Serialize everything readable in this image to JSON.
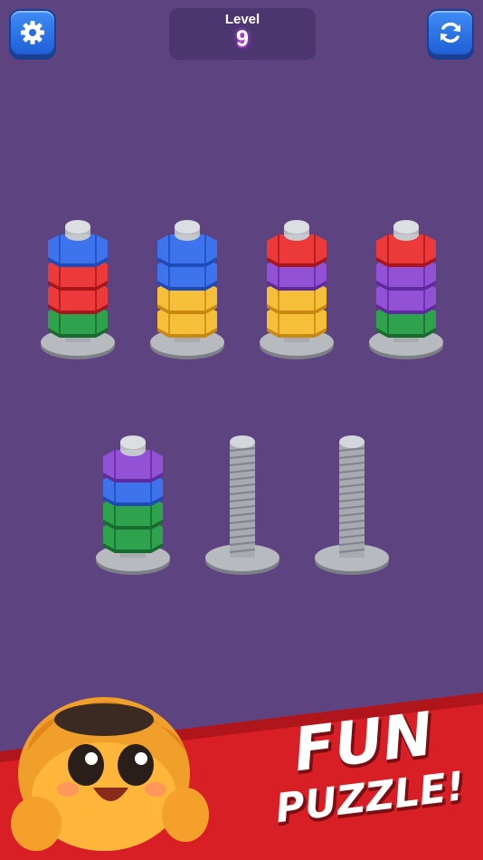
{
  "header": {
    "level_label": "Level",
    "level_number": "9"
  },
  "buttons": {
    "settings_icon": "gear-icon",
    "restart_icon": "refresh-icon"
  },
  "colors": {
    "background": "#5d4380",
    "blue": "#2a5bd7",
    "red": "#d81f26",
    "green": "#1d8a3a",
    "yellow": "#f2b01e",
    "purple": "#7d3fc2",
    "banner_red": "#d81f26"
  },
  "bolts": [
    {
      "nuts": [
        "green",
        "red",
        "red",
        "blue"
      ]
    },
    {
      "nuts": [
        "yellow",
        "yellow",
        "blue",
        "blue"
      ]
    },
    {
      "nuts": [
        "yellow",
        "yellow",
        "purple",
        "red"
      ]
    },
    {
      "nuts": [
        "green",
        "purple",
        "purple",
        "red"
      ]
    },
    {
      "nuts": [
        "green",
        "green",
        "blue",
        "purple"
      ]
    },
    {
      "nuts": []
    },
    {
      "nuts": []
    }
  ],
  "banner": {
    "line1": "FUN",
    "line2": "PUZZLE!"
  }
}
